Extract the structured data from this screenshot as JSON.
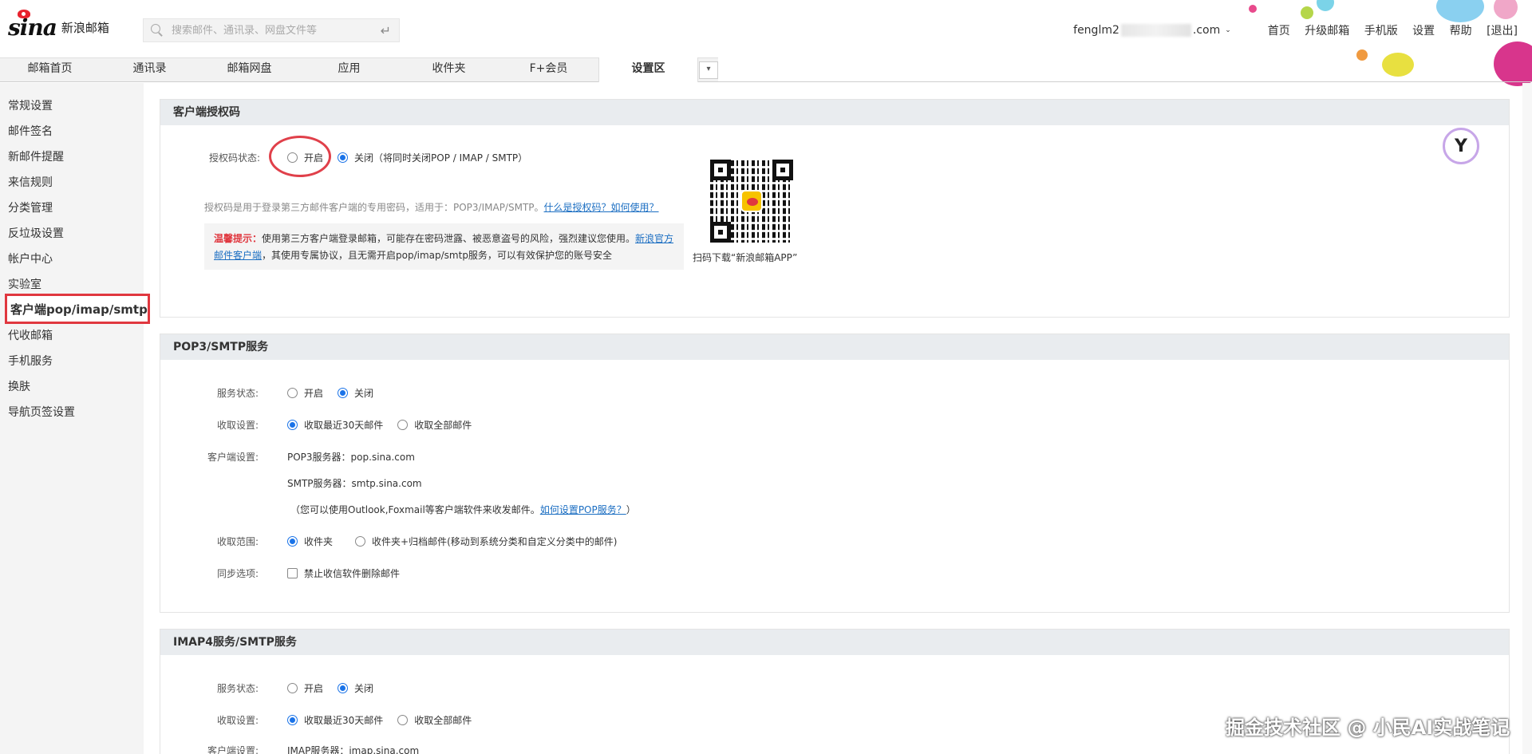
{
  "header": {
    "logo_text": "sina",
    "logo_sub": "新浪邮箱",
    "search_placeholder": "搜索邮件、通讯录、网盘文件等",
    "account_prefix": "fenglm2",
    "account_suffix": ".com",
    "links": [
      "首页",
      "升级邮箱",
      "手机版",
      "设置",
      "帮助",
      "[退出]"
    ]
  },
  "nav": {
    "tabs": [
      "邮箱首页",
      "通讯录",
      "邮箱网盘",
      "应用",
      "收件夹",
      "F+会员",
      "设置区"
    ],
    "active_tab": "设置区"
  },
  "sidebar": {
    "items": [
      "常规设置",
      "邮件签名",
      "新邮件提醒",
      "来信规则",
      "分类管理",
      "反垃圾设置",
      "帐户中心",
      "实验室",
      "客户端pop/imap/smtp",
      "代收邮箱",
      "手机服务",
      "换肤",
      "导航页签设置"
    ],
    "active_item": "客户端pop/imap/smtp"
  },
  "auth_panel": {
    "title": "客户端授权码",
    "status_label": "授权码状态:",
    "opt_on": "开启",
    "opt_off": "关闭（将同时关闭POP / IMAP / SMTP）",
    "desc": "授权码是用于登录第三方邮件客户端的专用密码，适用于：POP3/IMAP/SMTP。",
    "desc_link": "什么是授权码？如何使用？",
    "warn_title": "温馨提示：",
    "warn_text": "使用第三方客户端登录邮箱，可能存在密码泄露、被恶意盗号的风险，强烈建议您使用。",
    "warn_link": "新浪官方邮件客户端",
    "warn_text2": "，其使用专属协议，且无需开启pop/imap/smtp服务，可以有效保护您的账号安全",
    "qr_caption": "扫码下载“新浪邮箱APP”"
  },
  "pop_panel": {
    "title": "POP3/SMTP服务",
    "service_label": "服务状态:",
    "on": "开启",
    "off": "关闭",
    "receive_label": "收取设置:",
    "receive_30": "收取最近30天邮件",
    "receive_all": "收取全部邮件",
    "client_label": "客户端设置:",
    "pop_server": "POP3服务器：pop.sina.com",
    "smtp_server": "SMTP服务器：smtp.sina.com",
    "hint": "（您可以使用Outlook,Foxmail等客户端软件来收发邮件。",
    "hint_link": "如何设置POP服务？",
    "hint_end": "）",
    "range_label": "收取范围:",
    "range_inbox": "收件夹",
    "range_all": "收件夹+归档邮件(移动到系统分类和自定义分类中的邮件)",
    "sync_label": "同步选项:",
    "sync_opt": "禁止收信软件删除邮件"
  },
  "imap_panel": {
    "title": "IMAP4服务/SMTP服务",
    "service_label": "服务状态:",
    "on": "开启",
    "off": "关闭",
    "receive_label": "收取设置:",
    "receive_30": "收取最近30天邮件",
    "receive_all": "收取全部邮件",
    "client_label": "客户端设置:",
    "imap_server": "IMAP服务器：imap.sina.com"
  },
  "watermark": "掘金技术社区 @ 小民AI实战笔记",
  "colors": {
    "accent": "#1a73e8",
    "highlight": "#e0373f"
  }
}
